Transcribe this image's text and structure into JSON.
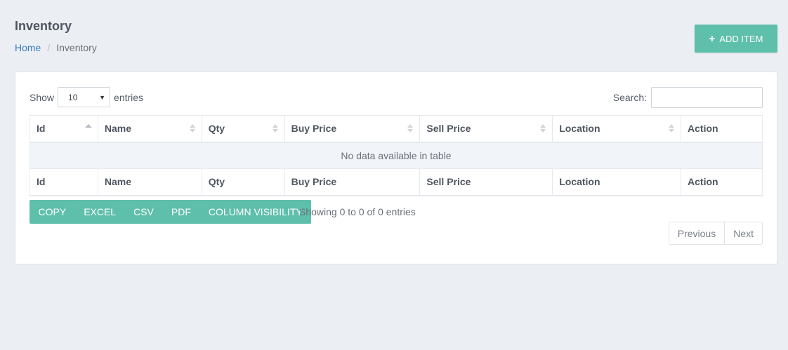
{
  "header": {
    "title": "Inventory",
    "breadcrumb": {
      "home": "Home",
      "current": "Inventory"
    },
    "add_button_label": "ADD ITEM"
  },
  "table_controls": {
    "show_label": "Show",
    "page_length": "10",
    "entries_label": "entries",
    "search_label": "Search:",
    "search_value": ""
  },
  "table": {
    "columns": [
      "Id",
      "Name",
      "Qty",
      "Buy Price",
      "Sell Price",
      "Location",
      "Action"
    ],
    "empty_message": "No data available in table"
  },
  "export_buttons": [
    "COPY",
    "EXCEL",
    "CSV",
    "PDF",
    "COLUMN VISIBILITY"
  ],
  "info_text": "Showing 0 to 0 of 0 entries",
  "pagination": {
    "previous": "Previous",
    "next": "Next"
  },
  "colors": {
    "accent": "#5ebfab",
    "link": "#3c7dbb",
    "background": "#ebeef3"
  }
}
